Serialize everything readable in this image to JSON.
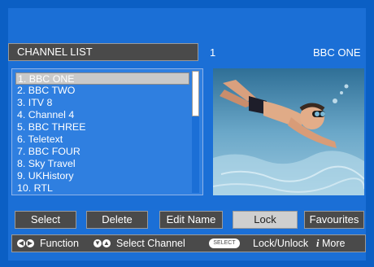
{
  "header": {
    "title": "CHANNEL LIST",
    "channel_number": "1",
    "channel_name": "BBC ONE"
  },
  "channels": [
    {
      "label": "1. BBC ONE",
      "selected": true
    },
    {
      "label": "2. BBC TWO",
      "selected": false
    },
    {
      "label": "3. ITV 8",
      "selected": false
    },
    {
      "label": "4. Channel 4",
      "selected": false
    },
    {
      "label": "5. BBC THREE",
      "selected": false
    },
    {
      "label": "6. Teletext",
      "selected": false
    },
    {
      "label": "7. BBC FOUR",
      "selected": false
    },
    {
      "label": "8. Sky Travel",
      "selected": false
    },
    {
      "label": "9. UKHistory",
      "selected": false
    },
    {
      "label": "10. RTL",
      "selected": false
    }
  ],
  "buttons": {
    "select": "Select",
    "delete": "Delete",
    "edit_name": "Edit Name",
    "lock": "Lock",
    "favourites": "Favourites"
  },
  "help": {
    "function": "Function",
    "select_channel": "Select Channel",
    "select_key": "SELECT",
    "lock_unlock": "Lock/Unlock",
    "more": "More"
  },
  "colors": {
    "background": "#1b6fd6",
    "bar": "#4a4a4a",
    "highlight": "#cfcfcf"
  }
}
